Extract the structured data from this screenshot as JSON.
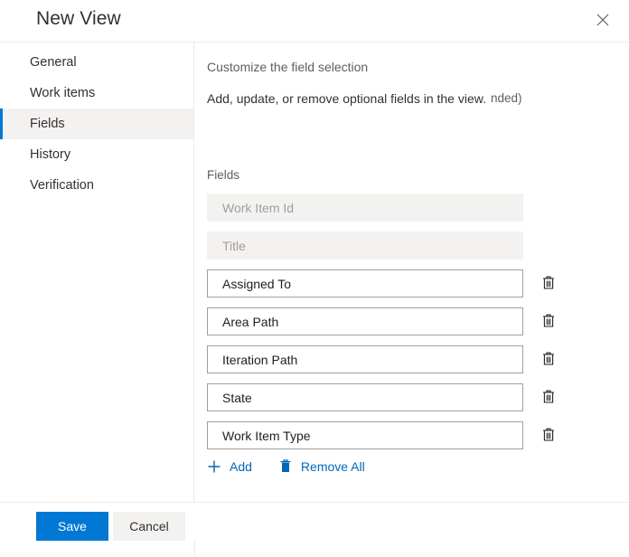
{
  "dialog": {
    "title": "New View",
    "close_label": "Close",
    "close_icon": "close-icon"
  },
  "sidebar": {
    "items": [
      {
        "label": "General",
        "selected": false
      },
      {
        "label": "Work items",
        "selected": false
      },
      {
        "label": "Fields",
        "selected": true
      },
      {
        "label": "History",
        "selected": false
      },
      {
        "label": "Verification",
        "selected": false
      }
    ]
  },
  "content": {
    "heading": "Customize the field selection",
    "description": "Add, update, or remove optional fields in the view.",
    "description_extra": "nded)",
    "fields_label": "Fields",
    "fields": [
      {
        "name": "Work Item Id",
        "disabled": true
      },
      {
        "name": "Title",
        "disabled": true
      },
      {
        "name": "Assigned To",
        "disabled": false
      },
      {
        "name": "Area Path",
        "disabled": false
      },
      {
        "name": "Iteration Path",
        "disabled": false
      },
      {
        "name": "State",
        "disabled": false
      },
      {
        "name": "Work Item Type",
        "disabled": false
      }
    ],
    "delete_label": "Delete field",
    "actions": {
      "add_label": "Add",
      "add_icon": "plus-icon",
      "remove_all_label": "Remove All",
      "remove_all_icon": "trash-filled-icon"
    }
  },
  "footer": {
    "save_label": "Save",
    "cancel_label": "Cancel"
  },
  "colors": {
    "accent": "#0078d4",
    "link": "#0067b8",
    "selected_bg": "#f3f2f1",
    "disabled_bg": "#f3f2f1",
    "border": "#a19f9d",
    "divider": "#edebe9"
  }
}
